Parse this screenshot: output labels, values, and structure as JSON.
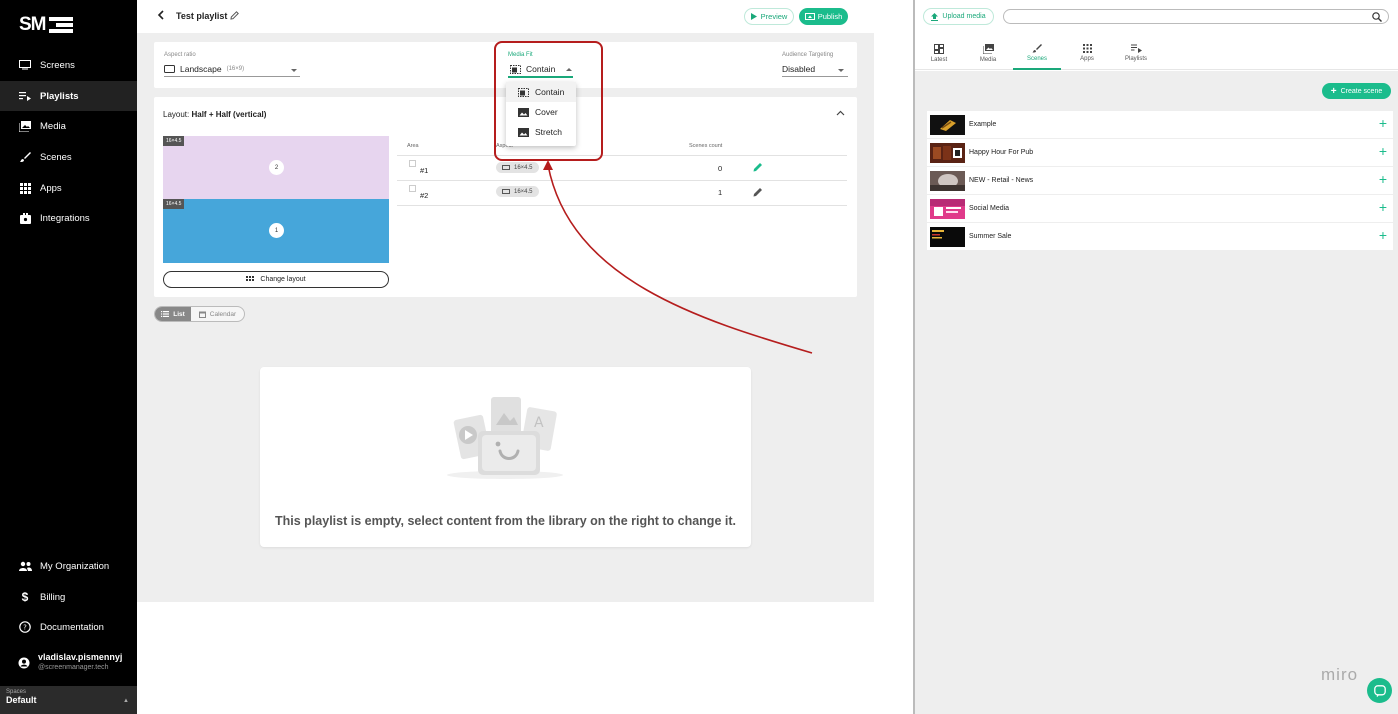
{
  "brand": {
    "logo": "SM"
  },
  "sidebar": {
    "items": [
      {
        "label": "Screens",
        "icon": "monitor-icon"
      },
      {
        "label": "Playlists",
        "icon": "playlist-icon"
      },
      {
        "label": "Media",
        "icon": "media-icon"
      },
      {
        "label": "Scenes",
        "icon": "brush-icon"
      },
      {
        "label": "Apps",
        "icon": "apps-grid-icon"
      },
      {
        "label": "Integrations",
        "icon": "integrations-icon"
      }
    ],
    "bottom": [
      {
        "label": "My Organization",
        "icon": "people-icon"
      },
      {
        "label": "Billing",
        "icon": "dollar-icon"
      },
      {
        "label": "Documentation",
        "icon": "help-icon"
      }
    ],
    "user": {
      "name": "vladislav.pismennyj",
      "email": "@screenmanager.tech"
    },
    "spaces": {
      "label": "Spaces",
      "value": "Default"
    }
  },
  "header": {
    "title": "Test playlist",
    "preview_label": "Preview",
    "publish_label": "Publish"
  },
  "settings": {
    "aspect_ratio": {
      "label": "Aspect ratio",
      "value": "Landscape",
      "hint": "(16×9)"
    },
    "media_fit": {
      "label": "Media Fit",
      "value": "Contain",
      "options": [
        "Contain",
        "Cover",
        "Stretch"
      ]
    },
    "audience": {
      "label": "Audience Targeting",
      "value": "Disabled"
    }
  },
  "layout": {
    "title_prefix": "Layout:",
    "title_value": "Half + Half (vertical)",
    "areas": [
      {
        "tag": "16×4.5",
        "num": "2"
      },
      {
        "tag": "16×4.5",
        "num": "1"
      }
    ],
    "change_label": "Change layout",
    "table": {
      "headers": [
        "Area",
        "Aspect",
        "Scenes count"
      ],
      "rows": [
        {
          "area": "#1",
          "aspect": "16×4.5",
          "count": "0"
        },
        {
          "area": "#2",
          "aspect": "16×4.5",
          "count": "1"
        }
      ]
    }
  },
  "view_toggle": {
    "list": "List",
    "calendar": "Calendar"
  },
  "empty_state": {
    "message": "This playlist is empty, select content from the library on the right to change it."
  },
  "library": {
    "upload_label": "Upload media",
    "search_placeholder": "",
    "tabs": [
      "Latest",
      "Media",
      "Scenes",
      "Apps",
      "Playlists"
    ],
    "active_tab": "Scenes",
    "create_label": "Create scene",
    "scenes": [
      "Example",
      "Happy Hour For Pub",
      "NEW - Retail - News",
      "Social Media",
      "Summer Sale"
    ]
  },
  "watermark": "miro",
  "colors": {
    "accent": "#1bbc8c",
    "sidebar": "#000000",
    "highlight": "#b51d1d"
  }
}
